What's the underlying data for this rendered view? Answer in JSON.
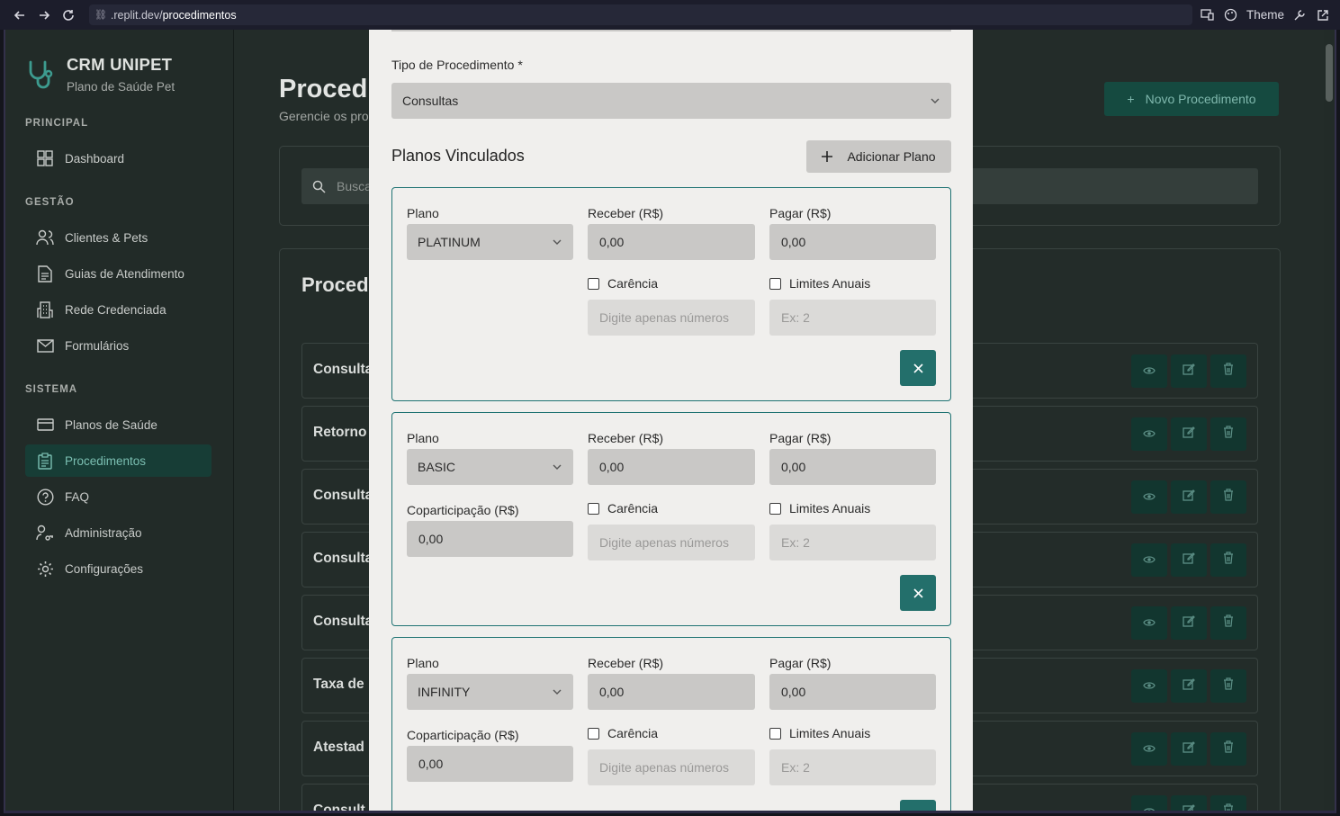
{
  "browser": {
    "url_prefix": ".replit.dev/",
    "url_path": "procedimentos",
    "theme_label": "Theme"
  },
  "sidebar": {
    "brand_title": "CRM UNIPET",
    "brand_subtitle": "Plano de Saúde Pet",
    "sections": {
      "principal": "PRINCIPAL",
      "gestao": "GESTÃO",
      "sistema": "SISTEMA"
    },
    "items": [
      {
        "label": "Dashboard",
        "icon": "grid-icon"
      },
      {
        "label": "Clientes & Pets",
        "icon": "users-icon"
      },
      {
        "label": "Guias de Atendimento",
        "icon": "file-icon"
      },
      {
        "label": "Rede Credenciada",
        "icon": "building-icon"
      },
      {
        "label": "Formulários",
        "icon": "mail-icon"
      },
      {
        "label": "Planos de Saúde",
        "icon": "card-icon"
      },
      {
        "label": "Procedimentos",
        "icon": "clipboard-icon",
        "active": true
      },
      {
        "label": "FAQ",
        "icon": "help-icon"
      },
      {
        "label": "Administração",
        "icon": "user-key-icon"
      },
      {
        "label": "Configurações",
        "icon": "gear-icon"
      }
    ]
  },
  "main": {
    "title": "Proced",
    "subtitle": "Gerencie os pro",
    "new_button": "Novo Procedimento",
    "search_placeholder": "Busca",
    "list_title": "Proced",
    "rows": [
      "Consulta",
      "Retorno",
      "Consulta",
      "Consulta",
      "Consulta",
      "Taxa de",
      "Atestad",
      "Consult"
    ]
  },
  "modal": {
    "tipo_label": "Tipo de Procedimento *",
    "tipo_value": "Consultas",
    "planos_title": "Planos Vinculados",
    "add_plan_button": "Adicionar Plano",
    "labels": {
      "plano": "Plano",
      "receber": "Receber (R$)",
      "pagar": "Pagar (R$)",
      "coparticipacao": "Coparticipação (R$)",
      "carencia": "Carência",
      "limites": "Limites Anuais"
    },
    "carencia_placeholder": "Digite apenas números",
    "limites_placeholder": "Ex: 2",
    "plans": [
      {
        "plano": "PLATINUM",
        "receber": "0,00",
        "pagar": "0,00"
      },
      {
        "plano": "BASIC",
        "receber": "0,00",
        "pagar": "0,00",
        "coparticipacao": "0,00"
      },
      {
        "plano": "INFINITY",
        "receber": "0,00",
        "pagar": "0,00",
        "coparticipacao": "0,00"
      }
    ]
  },
  "colors": {
    "accent": "#236f6b",
    "sidebar_active_bg": "#173d36",
    "modal_bg": "#f0efed"
  }
}
